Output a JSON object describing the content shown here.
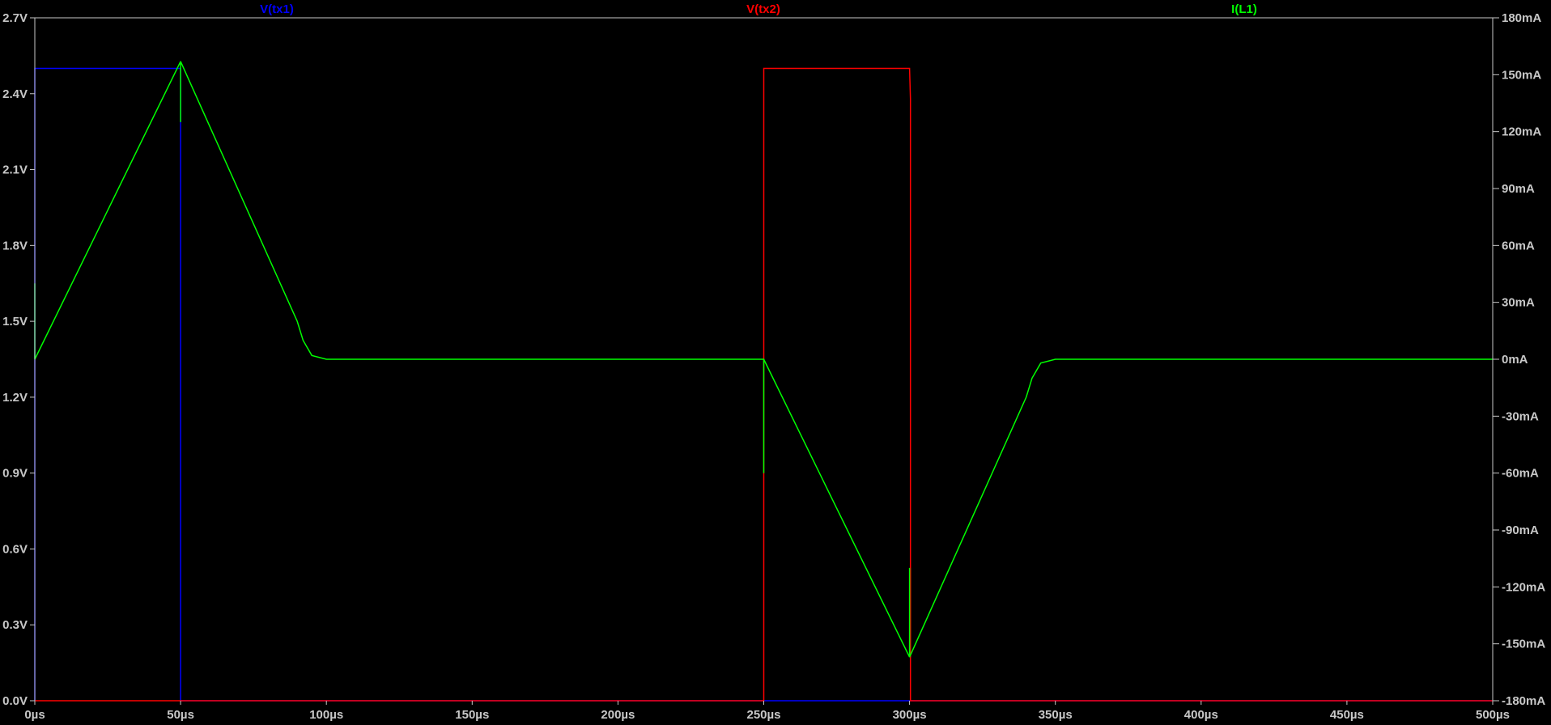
{
  "chart_data": {
    "type": "line",
    "title": "",
    "xlabel": "",
    "ylabel_left": "",
    "ylabel_right": "",
    "xlim": [
      0,
      500
    ],
    "ylim_left": [
      0,
      2.7
    ],
    "ylim_right": [
      -180,
      180
    ],
    "grid": false,
    "x_ticks": [
      "0µs",
      "50µs",
      "100µs",
      "150µs",
      "200µs",
      "250µs",
      "300µs",
      "350µs",
      "400µs",
      "450µs",
      "500µs"
    ],
    "x_tick_values": [
      0,
      50,
      100,
      150,
      200,
      250,
      300,
      350,
      400,
      450,
      500
    ],
    "left_ticks": [
      "0.0V",
      "0.3V",
      "0.6V",
      "0.9V",
      "1.2V",
      "1.5V",
      "1.8V",
      "2.1V",
      "2.4V",
      "2.7V"
    ],
    "left_tick_values": [
      0,
      0.3,
      0.6,
      0.9,
      1.2,
      1.5,
      1.8,
      2.1,
      2.4,
      2.7
    ],
    "right_ticks": [
      "-180mA",
      "-150mA",
      "-120mA",
      "-90mA",
      "-60mA",
      "-30mA",
      "0mA",
      "30mA",
      "60mA",
      "90mA",
      "120mA",
      "150mA",
      "180mA"
    ],
    "right_tick_values": [
      -180,
      -150,
      -120,
      -90,
      -60,
      -30,
      0,
      30,
      60,
      90,
      120,
      150,
      180
    ],
    "series": [
      {
        "name": "V(tx1)",
        "color": "#0000ff",
        "axis": "left",
        "x": [
          0,
          0,
          50,
          50,
          500
        ],
        "y": [
          0,
          2.5,
          2.5,
          0,
          0
        ]
      },
      {
        "name": "V(tx2)",
        "color": "#ff0000",
        "axis": "left",
        "x": [
          0,
          250,
          250,
          300,
          300.3,
          300.3,
          500
        ],
        "y": [
          0,
          0,
          2.5,
          2.5,
          2.38,
          0,
          0
        ]
      },
      {
        "name": "I(L1)",
        "color": "#00ff00",
        "axis": "right",
        "x": [
          0,
          0,
          0,
          50,
          50,
          50,
          90,
          92,
          95,
          100,
          250,
          250,
          250,
          300,
          300,
          300,
          340,
          342,
          345,
          350,
          500
        ],
        "y": [
          40,
          0,
          0,
          157,
          125,
          157,
          20,
          10,
          2,
          0,
          0,
          -60,
          0,
          -157,
          -110,
          -157,
          -20,
          -10,
          -2,
          0,
          0
        ]
      }
    ]
  }
}
